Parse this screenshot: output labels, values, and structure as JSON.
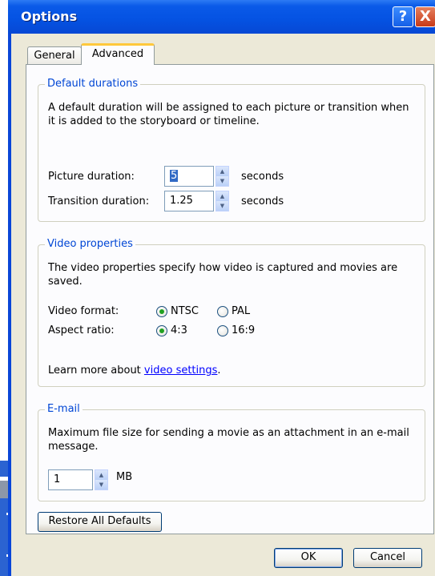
{
  "window": {
    "title": "Options",
    "help_glyph": "?",
    "close_glyph": "X"
  },
  "tabs": [
    {
      "label": "General",
      "active": false
    },
    {
      "label": "Advanced",
      "active": true
    }
  ],
  "default_durations": {
    "heading": "Default durations",
    "description": "A default duration will be assigned to each picture or transition when it is added to the storyboard or timeline.",
    "picture": {
      "label": "Picture duration:",
      "value": "5",
      "unit": "seconds"
    },
    "transition": {
      "label": "Transition duration:",
      "value": "1.25",
      "unit": "seconds"
    }
  },
  "video_properties": {
    "heading": "Video properties",
    "description": "The video properties specify how video is captured and movies are saved.",
    "format": {
      "label": "Video format:",
      "options": [
        {
          "label": "NTSC",
          "selected": true
        },
        {
          "label": "PAL",
          "selected": false
        }
      ]
    },
    "aspect": {
      "label": "Aspect ratio:",
      "options": [
        {
          "label": "4:3",
          "selected": true
        },
        {
          "label": "16:9",
          "selected": false
        }
      ]
    },
    "learn_more_prefix": "Learn more about ",
    "learn_more_link": "video settings",
    "learn_more_suffix": "."
  },
  "email": {
    "heading": "E-mail",
    "description": "Maximum file size for sending a movie as an attachment in an e-mail message.",
    "size": {
      "value": "1",
      "unit": "MB"
    }
  },
  "buttons": {
    "restore": "Restore All Defaults",
    "ok": "OK",
    "cancel": "Cancel"
  },
  "colors": {
    "title_bar": "#0553e3",
    "dialog_face": "#ece9d8",
    "group_heading": "#0046d5",
    "active_tab_accent": "#ffc83c",
    "radio_selected": "#21a121"
  },
  "icons": {
    "spin_up": "▲",
    "spin_down": "▼"
  }
}
